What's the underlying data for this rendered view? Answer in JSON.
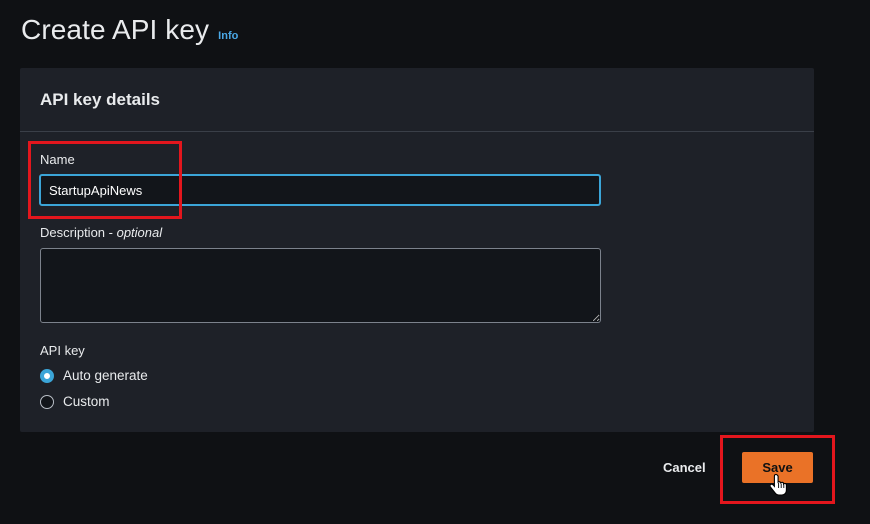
{
  "header": {
    "title": "Create API key",
    "info_link": "Info"
  },
  "card": {
    "title": "API key details"
  },
  "name": {
    "label": "Name",
    "value": "StartupApiNews"
  },
  "description": {
    "label": "Description",
    "optional": "optional",
    "value": ""
  },
  "api_key": {
    "label": "API key",
    "options": [
      {
        "label": "Auto generate",
        "selected": true
      },
      {
        "label": "Custom",
        "selected": false
      }
    ]
  },
  "actions": {
    "cancel_label": "Cancel",
    "save_label": "Save"
  },
  "colors": {
    "accent": "#ea7227",
    "focus": "#3ba5d8",
    "highlight": "#e3161d",
    "link": "#4aa8e6"
  }
}
